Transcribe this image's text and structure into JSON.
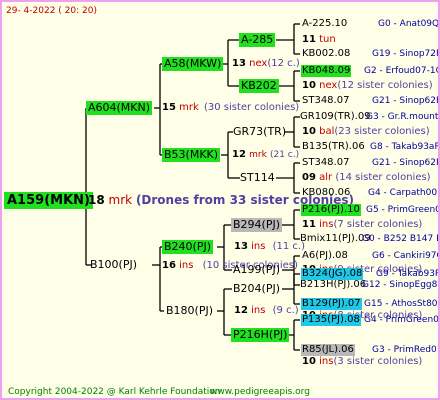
{
  "header": {
    "date": "29-   4-2022  ( 20:  20)"
  },
  "root": {
    "id": "A159(MKN)",
    "count": "18",
    "unit": "mrk",
    "note": "(Drones from 33 sister colonies)"
  },
  "gen1": {
    "upper": {
      "id": "A604(MKN)",
      "count": "15",
      "unit": "mrk",
      "note": "(30 sister colonies)"
    },
    "lower": {
      "id": "B100(PJ)",
      "count": "16",
      "unit": "ins",
      "note": "(10 sister colonies)"
    }
  },
  "gen2": {
    "a58": {
      "id": "A58(MKW)",
      "count": "13",
      "unit": "nex",
      "note": "(12 c.)"
    },
    "b53": {
      "id": "B53(MKK)",
      "count": "12",
      "unit": "mrk",
      "note": "(21 c.)"
    },
    "b240": {
      "id": "B240(PJ)",
      "count": "13",
      "unit": "ins",
      "note": "(11 c.)"
    },
    "b180": {
      "id": "B180(PJ)",
      "count": "12",
      "unit": "ins",
      "note": "(9 c.)"
    }
  },
  "gen3": {
    "a285": {
      "id": "A-285",
      "count": "11",
      "unit": "tun"
    },
    "kb202": {
      "id": "KB202",
      "count": "10",
      "unit": "nex",
      "note": "(12 sister colonies)"
    },
    "gr73": {
      "id": "GR73(TR)",
      "count": "10",
      "unit": "bal",
      "note": "(23 sister colonies)"
    },
    "st114": {
      "id": "ST114",
      "count": "09",
      "unit": "alr",
      "note": "(14 sister colonies)"
    },
    "b294": {
      "id": "B294(PJ)",
      "count": "11",
      "unit": "ins",
      "note": "(7 sister colonies)"
    },
    "a199": {
      "id": "A199(PJ)",
      "count": "10",
      "unit": "ins",
      "note": "(9 sister colonies)"
    },
    "b204": {
      "id": "B204(PJ)",
      "count": "10",
      "unit": "ins",
      "note": "(8 sister colonies)"
    },
    "p216h": {
      "id": "P216H(PJ)",
      "count": "10",
      "unit": "ins",
      "note": "(3 sister colonies)"
    }
  },
  "gen4": [
    {
      "id": "A-225.10",
      "source": "G0 - Anat09Q"
    },
    {
      "id": "KB002.08",
      "source": "G19 - Sinop72R"
    },
    {
      "id": "KB048.09",
      "source": "G2 - Erfoud07-1Q"
    },
    {
      "id": "ST348.07",
      "source": "G21 - Sinop62R"
    },
    {
      "id": "GR109(TR).09",
      "source": "G3 - Gr.R.mounta"
    },
    {
      "id": "B135(TR).06",
      "source": "G8 - Takab93aR"
    },
    {
      "id": "ST348.07",
      "source": "G21 - Sinop62R"
    },
    {
      "id": "KB080.06",
      "source": "G4 - Carpath00R"
    },
    {
      "id": "P216(PJ).10",
      "source": "G5 - PrimGreen00"
    },
    {
      "id": "Bmix11(PJ).09",
      "source": "G0 - B252 B147 B"
    },
    {
      "id": "A6(PJ).08",
      "source": "G6 - Cankiri97Q"
    },
    {
      "id": "B213H(PJ).06",
      "source": "G12 - SinopEgg86R"
    },
    {
      "id": "B324(JG).08",
      "source": "G9 - Takab93R"
    },
    {
      "id": "B129(PJ).07",
      "source": "G15 - AthosSt80R"
    },
    {
      "id": "P135(PJ).08",
      "source": "G4 - PrimGreen00"
    },
    {
      "id": "R85(JL).06",
      "source": "G3 - PrimRed01"
    }
  ],
  "footer": {
    "copyright": "Copyright 2004-2022 @ Karl Kehrle Foundation",
    "site": "www.pedigreeapis.org"
  },
  "colors": {
    "highlight_green": "#20e020",
    "highlight_grey": "#b8b8b8",
    "highlight_cyan": "#20c8e8",
    "label_red": "#c00000",
    "label_blue": "#0000a0",
    "background": "#ffffe8",
    "border": "#f0a0f0"
  }
}
